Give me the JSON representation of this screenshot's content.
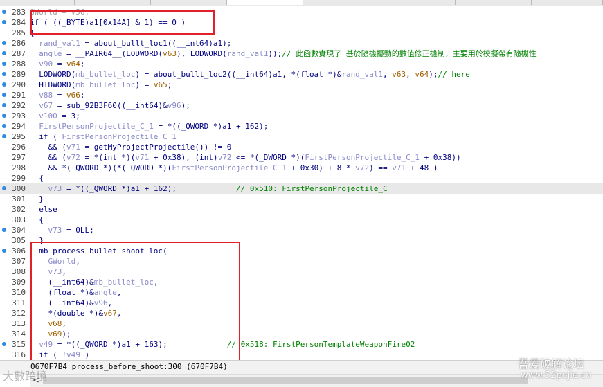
{
  "tabs": [
    {
      "label": "",
      "active": false
    },
    {
      "label": "",
      "active": false
    },
    {
      "label": "",
      "active": false
    },
    {
      "label": "",
      "active": true
    },
    {
      "label": "",
      "active": false
    },
    {
      "label": "",
      "active": false
    },
    {
      "label": "",
      "active": false
    },
    {
      "label": "",
      "active": false
    }
  ],
  "lines": [
    {
      "n": "283",
      "bp": true,
      "hl": false,
      "t": [
        [
          "GWorld = v56;",
          "x"
        ]
      ]
    },
    {
      "n": "284",
      "bp": true,
      "hl": false,
      "t": [
        [
          "if ( ((_BYTE)a1[0x14A] & 1) == 0 )",
          "c"
        ]
      ]
    },
    {
      "n": "285",
      "bp": false,
      "hl": false,
      "t": [
        [
          "{",
          "c"
        ]
      ]
    },
    {
      "n": "286",
      "bp": true,
      "hl": false,
      "t": [
        [
          "  ",
          "c"
        ],
        [
          "rand_val1",
          "v"
        ],
        [
          " = about_bullt_loc1((__int64)a1);",
          "c"
        ]
      ]
    },
    {
      "n": "287",
      "bp": true,
      "hl": false,
      "t": [
        [
          "  ",
          "c"
        ],
        [
          "angle",
          "v"
        ],
        [
          " = __PAIR64__(LODWORD(",
          "c"
        ],
        [
          "v63",
          "o"
        ],
        [
          "), LODWORD(",
          "c"
        ],
        [
          "rand_val1",
          "v"
        ],
        [
          "));",
          "c"
        ],
        [
          "// 此函數實現了 基於隨機擾動的數值修正機制，主要用於模擬帶有隨機性",
          "cm"
        ]
      ]
    },
    {
      "n": "288",
      "bp": true,
      "hl": false,
      "t": [
        [
          "  ",
          "c"
        ],
        [
          "v90",
          "v"
        ],
        [
          " = ",
          "c"
        ],
        [
          "v64",
          "o"
        ],
        [
          ";",
          "c"
        ]
      ]
    },
    {
      "n": "289",
      "bp": true,
      "hl": false,
      "t": [
        [
          "  LODWORD(",
          "c"
        ],
        [
          "mb_bullet_loc",
          "v"
        ],
        [
          ") = about_bullt_loc2((__int64)a1, *(float *)&",
          "c"
        ],
        [
          "rand_val1",
          "v"
        ],
        [
          ", ",
          "c"
        ],
        [
          "v63",
          "o"
        ],
        [
          ", ",
          "c"
        ],
        [
          "v64",
          "o"
        ],
        [
          ");",
          "c"
        ],
        [
          "// here",
          "cm"
        ]
      ]
    },
    {
      "n": "290",
      "bp": true,
      "hl": false,
      "t": [
        [
          "  HIDWORD(",
          "c"
        ],
        [
          "mb_bullet_loc",
          "v"
        ],
        [
          ") = ",
          "c"
        ],
        [
          "v65",
          "o"
        ],
        [
          ";",
          "c"
        ]
      ]
    },
    {
      "n": "291",
      "bp": true,
      "hl": false,
      "t": [
        [
          "  ",
          "c"
        ],
        [
          "v88",
          "v"
        ],
        [
          " = ",
          "c"
        ],
        [
          "v66",
          "o"
        ],
        [
          ";",
          "c"
        ]
      ]
    },
    {
      "n": "292",
      "bp": true,
      "hl": false,
      "t": [
        [
          "  ",
          "c"
        ],
        [
          "v67",
          "v"
        ],
        [
          " = sub_92B3F60((__int64)&",
          "c"
        ],
        [
          "v96",
          "v"
        ],
        [
          ");",
          "c"
        ]
      ]
    },
    {
      "n": "293",
      "bp": true,
      "hl": false,
      "t": [
        [
          "  ",
          "c"
        ],
        [
          "v100",
          "v"
        ],
        [
          " = 3;",
          "c"
        ]
      ]
    },
    {
      "n": "294",
      "bp": true,
      "hl": false,
      "t": [
        [
          "  ",
          "c"
        ],
        [
          "FirstPersonProjectile_C_1",
          "v"
        ],
        [
          " = *((_QWORD *)a1 + 162);",
          "c"
        ]
      ]
    },
    {
      "n": "295",
      "bp": true,
      "hl": false,
      "t": [
        [
          "  if ( ",
          "c"
        ],
        [
          "FirstPersonProjectile_C_1",
          "v"
        ]
      ]
    },
    {
      "n": "296",
      "bp": false,
      "hl": false,
      "t": [
        [
          "    && (",
          "c"
        ],
        [
          "v71",
          "v"
        ],
        [
          " = getMyProjectProjectile()) != 0",
          "c"
        ]
      ]
    },
    {
      "n": "297",
      "bp": false,
      "hl": false,
      "t": [
        [
          "    && (",
          "c"
        ],
        [
          "v72",
          "v"
        ],
        [
          " = *(int *)(",
          "c"
        ],
        [
          "v71",
          "v"
        ],
        [
          " + 0x38), (int)",
          "c"
        ],
        [
          "v72",
          "v"
        ],
        [
          " <= *(_DWORD *)(",
          "c"
        ],
        [
          "FirstPersonProjectile_C_1",
          "v"
        ],
        [
          " + 0x38))",
          "c"
        ]
      ]
    },
    {
      "n": "298",
      "bp": false,
      "hl": false,
      "t": [
        [
          "    && *(_QWORD *)(*(_QWORD *)(",
          "c"
        ],
        [
          "FirstPersonProjectile_C_1",
          "v"
        ],
        [
          " + 0x30) + 8 * ",
          "c"
        ],
        [
          "v72",
          "v"
        ],
        [
          ") == ",
          "c"
        ],
        [
          "v71",
          "v"
        ],
        [
          " + 48 )",
          "c"
        ]
      ]
    },
    {
      "n": "299",
      "bp": false,
      "hl": false,
      "t": [
        [
          "  {",
          "c"
        ]
      ]
    },
    {
      "n": "300",
      "bp": true,
      "hl": true,
      "t": [
        [
          "    ",
          "c"
        ],
        [
          "v73",
          "v"
        ],
        [
          " = *((_QWORD *)a1 + 162);             ",
          "c"
        ],
        [
          "// 0x510: FirstPersonProjectile_C",
          "cm"
        ]
      ]
    },
    {
      "n": "301",
      "bp": false,
      "hl": false,
      "t": [
        [
          "  }",
          "c"
        ]
      ]
    },
    {
      "n": "302",
      "bp": false,
      "hl": false,
      "t": [
        [
          "  else",
          "c"
        ]
      ]
    },
    {
      "n": "303",
      "bp": false,
      "hl": false,
      "t": [
        [
          "  {",
          "c"
        ]
      ]
    },
    {
      "n": "304",
      "bp": true,
      "hl": false,
      "t": [
        [
          "    ",
          "c"
        ],
        [
          "v73",
          "v"
        ],
        [
          " = 0LL;",
          "c"
        ]
      ]
    },
    {
      "n": "305",
      "bp": false,
      "hl": false,
      "t": [
        [
          "  }",
          "c"
        ]
      ]
    },
    {
      "n": "306",
      "bp": true,
      "hl": false,
      "t": [
        [
          "  mb_process_bullet_shoot_loc(",
          "c"
        ]
      ]
    },
    {
      "n": "307",
      "bp": false,
      "hl": false,
      "t": [
        [
          "    ",
          "c"
        ],
        [
          "GWorld",
          "v"
        ],
        [
          ",",
          "c"
        ]
      ]
    },
    {
      "n": "308",
      "bp": false,
      "hl": false,
      "t": [
        [
          "    ",
          "c"
        ],
        [
          "v73",
          "v"
        ],
        [
          ",",
          "c"
        ]
      ]
    },
    {
      "n": "309",
      "bp": false,
      "hl": false,
      "t": [
        [
          "    (__int64)&",
          "c"
        ],
        [
          "mb_bullet_loc",
          "v"
        ],
        [
          ",",
          "c"
        ]
      ]
    },
    {
      "n": "310",
      "bp": false,
      "hl": false,
      "t": [
        [
          "    (float *)&",
          "c"
        ],
        [
          "angle",
          "v"
        ],
        [
          ",",
          "c"
        ]
      ]
    },
    {
      "n": "311",
      "bp": false,
      "hl": false,
      "t": [
        [
          "    (__int64)&",
          "c"
        ],
        [
          "v96",
          "v"
        ],
        [
          ",",
          "c"
        ]
      ]
    },
    {
      "n": "312",
      "bp": false,
      "hl": false,
      "t": [
        [
          "    *(double *)&",
          "c"
        ],
        [
          "v67",
          "o"
        ],
        [
          ",",
          "c"
        ]
      ]
    },
    {
      "n": "313",
      "bp": false,
      "hl": false,
      "t": [
        [
          "    ",
          "c"
        ],
        [
          "v68",
          "o"
        ],
        [
          ",",
          "c"
        ]
      ]
    },
    {
      "n": "314",
      "bp": false,
      "hl": false,
      "t": [
        [
          "    ",
          "c"
        ],
        [
          "v69",
          "o"
        ],
        [
          ");",
          "c"
        ]
      ]
    },
    {
      "n": "315",
      "bp": true,
      "hl": false,
      "t": [
        [
          "  ",
          "c"
        ],
        [
          "v49",
          "v"
        ],
        [
          " = *((_QWORD *)a1 + 163);             ",
          "c"
        ],
        [
          "// 0x518: FirstPersonTemplateWeaponFire02",
          "cm"
        ]
      ]
    },
    {
      "n": "316",
      "bp": false,
      "hl": false,
      "t": [
        [
          "  if ( !",
          "c"
        ],
        [
          "v49",
          "v"
        ],
        [
          " )",
          "c"
        ]
      ]
    }
  ],
  "status": {
    "text": "0670F7B4 process_before_shoot:300 (670F7B4)"
  },
  "watermark": {
    "left": "大數跨境",
    "right_title": "吾爱破解论坛",
    "right_url": "www.52pojie.cn"
  },
  "scroll_arrow": "<",
  "colors": {
    "highlight_box": "#e0202a",
    "breakpoint": "#2d8be6",
    "comment": "#008000",
    "line_highlight": "#e8e8e8"
  }
}
